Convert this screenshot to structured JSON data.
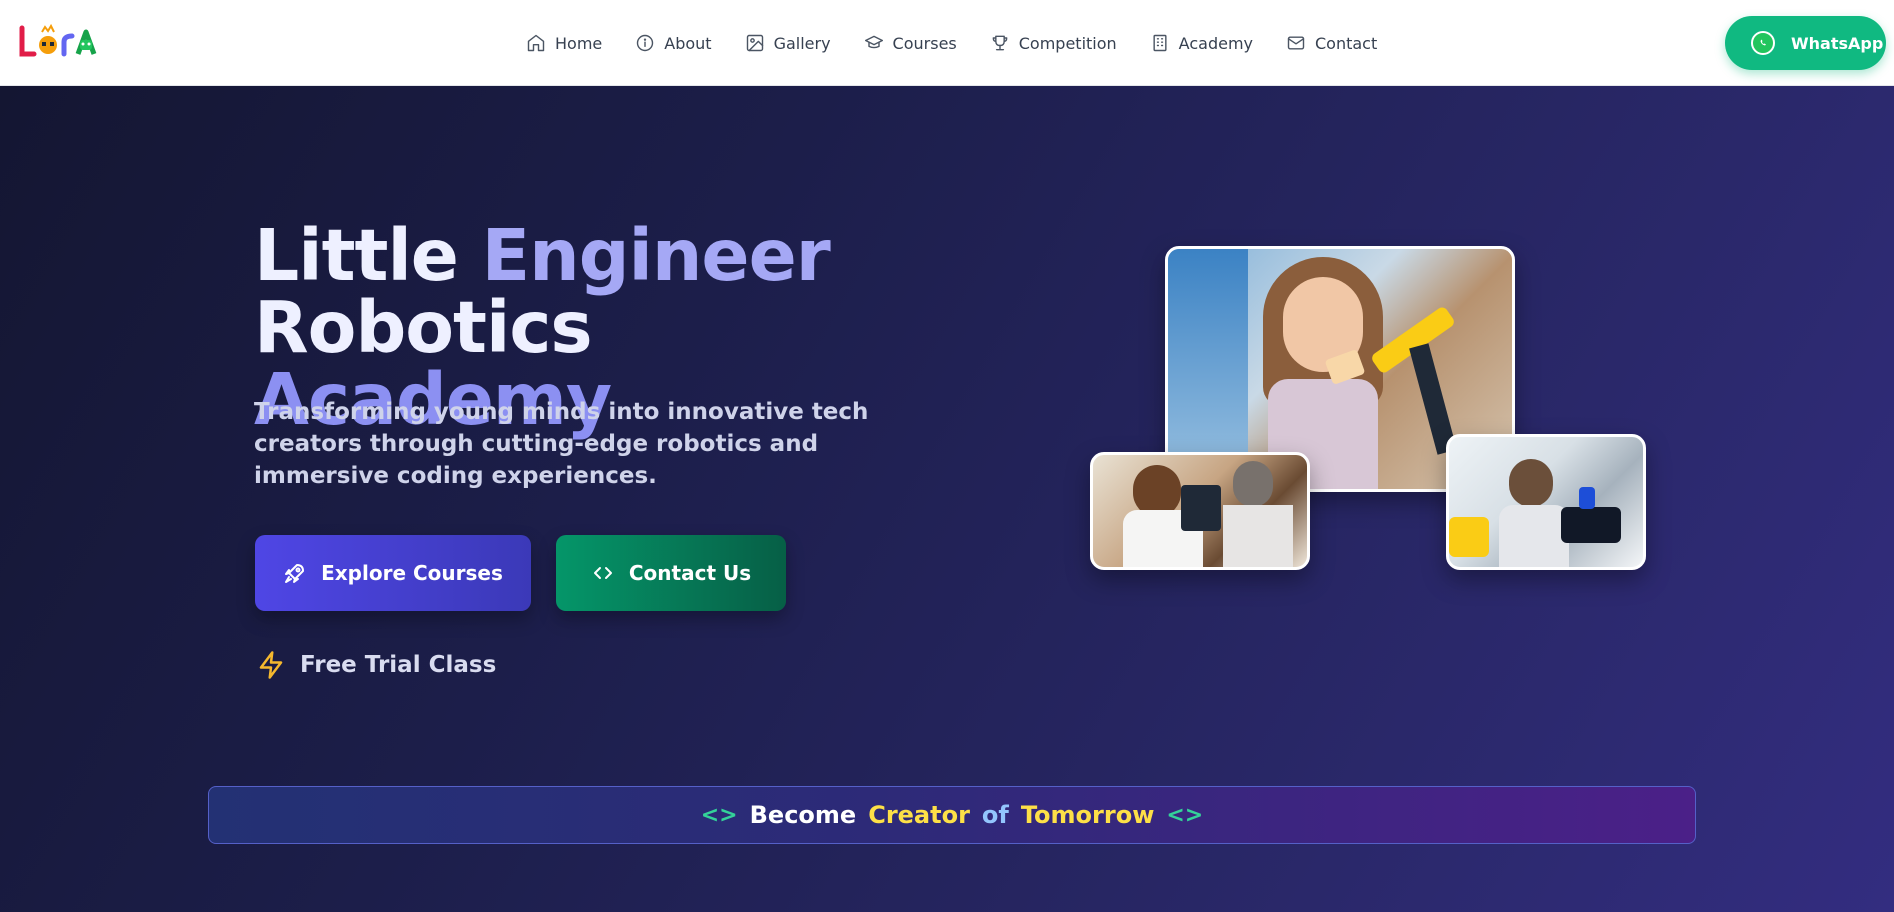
{
  "navbar": {
    "logo_text": "LeRA",
    "links": [
      {
        "label": "Home",
        "icon": "home-icon"
      },
      {
        "label": "About",
        "icon": "info-icon"
      },
      {
        "label": "Gallery",
        "icon": "image-icon"
      },
      {
        "label": "Courses",
        "icon": "graduation-cap-icon"
      },
      {
        "label": "Competition",
        "icon": "trophy-icon"
      },
      {
        "label": "Academy",
        "icon": "building-icon"
      },
      {
        "label": "Contact",
        "icon": "mail-icon"
      }
    ],
    "whatsapp_label": "WhatsApp"
  },
  "hero": {
    "title_word1": "Little",
    "title_word2": "Engineer",
    "title_word3": "Robotics",
    "title_word4": "Academy",
    "subtitle": "Transforming young minds into innovative tech creators through cutting-edge robotics and immersive coding experiences.",
    "primary_button": "Explore Courses",
    "secondary_button": "Contact Us",
    "trial_label": "Free Trial Class"
  },
  "banner": {
    "word1": "Become",
    "word2": "Creator",
    "word3": "of",
    "word4": "Tomorrow",
    "open_code": "<>",
    "close_code": "<>"
  },
  "colors": {
    "primary": "#4f46e5",
    "secondary": "#059669",
    "whatsapp": "#10b981",
    "highlight": "#fde047",
    "accent_text": "#a5a8f5"
  }
}
